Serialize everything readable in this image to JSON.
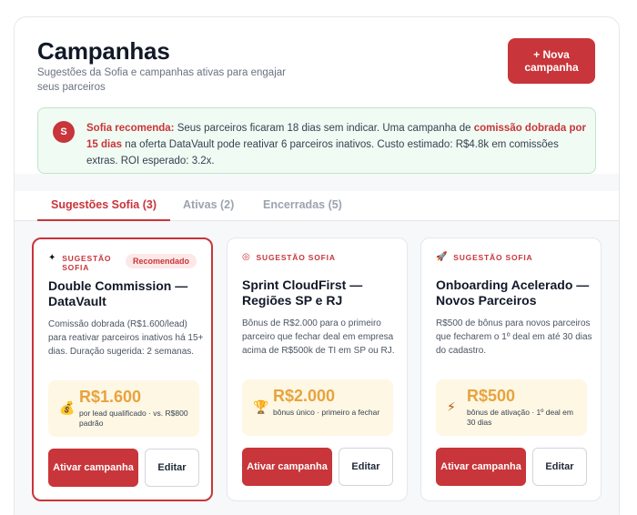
{
  "header": {
    "title": "Campanhas",
    "subtitle": "Sugestões da Sofia e campanhas ativas para engajar seus parceiros",
    "new_button": "+ Nova campanha"
  },
  "recommendation": {
    "avatar": "S",
    "lead": "Sofia recomenda:",
    "text1": " Seus parceiros ficaram 18 dias sem indicar. Uma campanha de ",
    "highlight": "comissão dobrada por 15 dias",
    "text2": " na oferta DataVault pode reativar 6 parceiros inativos. Custo estimado: R$4.8k em comissões extras. ROI esperado: 3.2x."
  },
  "tabs": [
    {
      "label": "Sugestões Sofia (3)",
      "active": true
    },
    {
      "label": "Ativas (2)",
      "active": false
    },
    {
      "label": "Encerradas (5)",
      "active": false
    }
  ],
  "cards": [
    {
      "tag": "SUGESTÃO SOFIA",
      "tag_icon": "sparkle-icon",
      "badge": "Recomendado",
      "title": "Double Commission — DataVault",
      "description": "Comissão dobrada (R$1.600/lead) para reativar parceiros inativos há 15+ dias. Duração sugerida: 2 semanas.",
      "amount_icon": "money-bag-icon",
      "amount": "R$1.600",
      "amount_note": "por lead qualificado · vs. R$800 padrão",
      "primary_label": "Ativar campanha",
      "secondary_label": "Editar"
    },
    {
      "tag": "SUGESTÃO SOFIA",
      "tag_icon": "target-icon",
      "badge": "",
      "title": "Sprint CloudFirst — Regiões SP e RJ",
      "description": "Bônus de R$2.000 para o primeiro parceiro que fechar deal em empresa acima de R$500k de TI em SP ou RJ.",
      "amount_icon": "trophy-icon",
      "amount": "R$2.000",
      "amount_note": "bônus único · primeiro a fechar",
      "primary_label": "Ativar campanha",
      "secondary_label": "Editar"
    },
    {
      "tag": "SUGESTÃO SOFIA",
      "tag_icon": "rocket-icon",
      "badge": "",
      "title": "Onboarding Acelerado — Novos Parceiros",
      "description": "R$500 de bônus para novos parceiros que fecharem o 1º deal em até 30 dias do cadastro.",
      "amount_icon": "lightning-icon",
      "amount": "R$500",
      "amount_note": "bônus de ativação · 1º deal em 30 dias",
      "primary_label": "Ativar campanha",
      "secondary_label": "Editar"
    }
  ],
  "colors": {
    "accent": "#c8353a",
    "amount": "#e8a33d",
    "reco_bg": "#f0fbf3"
  }
}
